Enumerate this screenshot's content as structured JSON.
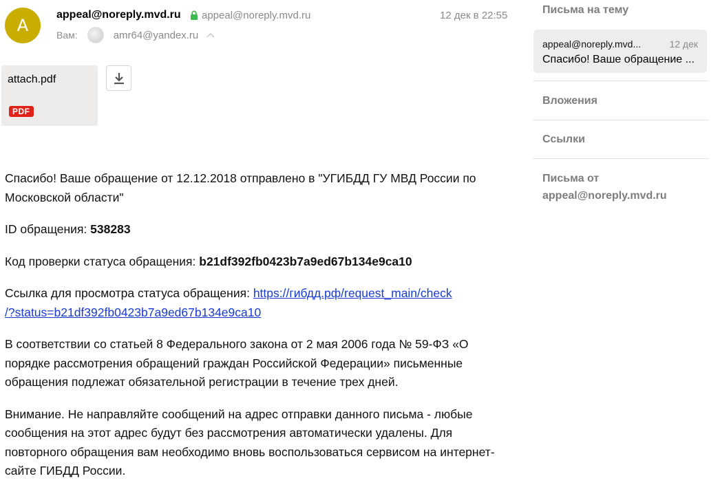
{
  "header": {
    "avatar_letter": "A",
    "avatar_color": "#c9ae00",
    "from_name": "appeal@noreply.mvd.ru",
    "from_address": "appeal@noreply.mvd.ru",
    "date": "12 дек в 22:55",
    "to_label": "Вам:",
    "to_address": "amr64@yandex.ru"
  },
  "attachment": {
    "filename": "attach.pdf",
    "badge": "PDF",
    "badge_color": "#e0231a"
  },
  "body": {
    "p1": "Спасибо! Ваше обращение от 12.12.2018 отправлено в \"УГИБДД ГУ МВД России по Московской области\"",
    "p2_label": "ID обращения: ",
    "p2_value": "538283",
    "p3_label": "Код проверки статуса обращения: ",
    "p3_value": "b21df392fb0423b7a9ed67b134e9ca10",
    "p4_label": "Ссылка для просмотра статуса обращения: ",
    "p4_link_part1": "https://гибдд.рф/request_main/check",
    "p4_link_part2": "/?status=b21df392fb0423b7a9ed67b134e9ca10",
    "p5": "В соответствии со статьей 8 Федерального закона от 2 мая 2006 года № 59-ФЗ «О порядке рассмотрения обращений граждан Российской Федерации» письменные обращения подлежат обязательной регистрации в течение трех дней.",
    "p6": "Внимание. Не направляйте сообщений на адрес отправки данного письма - любые сообщения на этот адрес будут без рассмотрения автоматически удалены. Для повторного обращения вам необходимо вновь воспользоваться сервисом на интернет-сайте ГИБДД России.",
    "link_color": "#1a3bd0"
  },
  "sidebar": {
    "thread_title": "Письма на тему",
    "thread_item": {
      "from": "appeal@noreply.mvd...",
      "date": "12 дек",
      "subject": "Спасибо! Ваше обращение ..."
    },
    "attachments_title": "Вложения",
    "links_title": "Ссылки",
    "from_title_line1": "Письма от",
    "from_title_line2": "appeal@noreply.mvd.ru"
  }
}
